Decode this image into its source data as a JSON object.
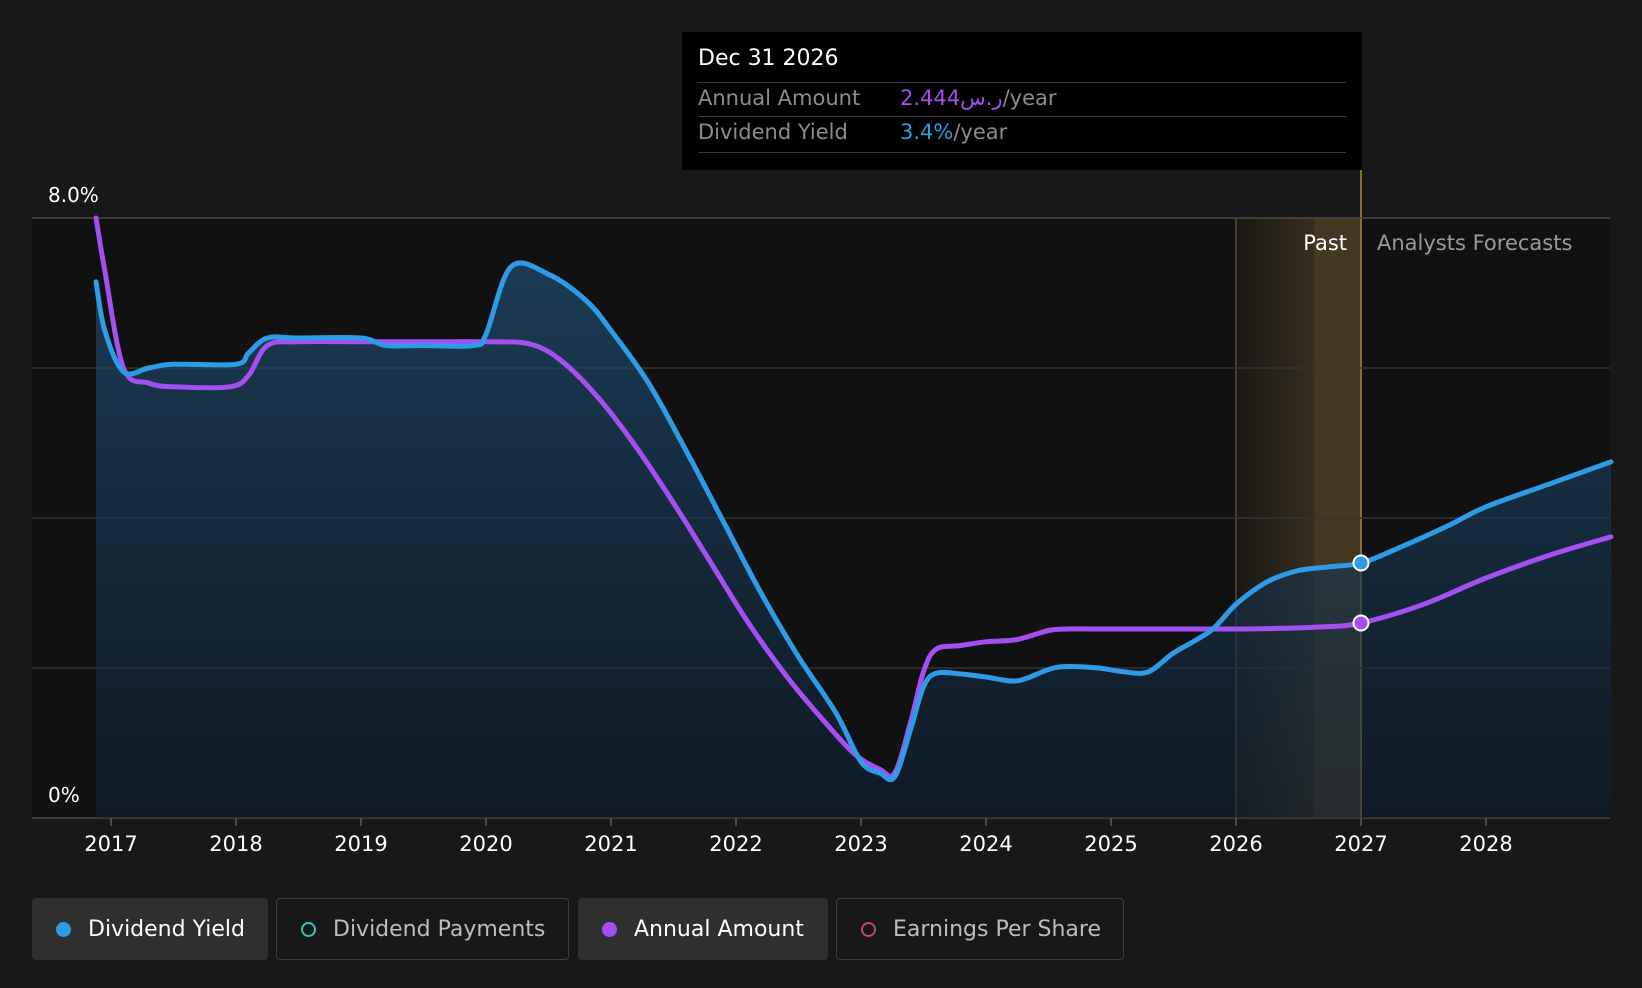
{
  "tooltip": {
    "date": "Dec 31 2026",
    "rows": [
      {
        "label": "Annual Amount",
        "value": "2.444ر.س",
        "unit": "/year",
        "color": "#a34ff2"
      },
      {
        "label": "Dividend Yield",
        "value": "3.4%",
        "unit": "/year",
        "color": "#2e9be6"
      }
    ]
  },
  "legend": [
    {
      "label": "Dividend Yield",
      "color": "#2e9be6",
      "active": true,
      "filled": true
    },
    {
      "label": "Dividend Payments",
      "color": "#3fc1b0",
      "active": false,
      "filled": false
    },
    {
      "label": "Annual Amount",
      "color": "#a34ff2",
      "active": true,
      "filled": true
    },
    {
      "label": "Earnings Per Share",
      "color": "#c0447e",
      "active": false,
      "filled": false
    }
  ],
  "chart_data": {
    "type": "line",
    "y_tick_labels": [
      "8.0%",
      "0%"
    ],
    "ylim": [
      0,
      8
    ],
    "xlim": [
      2016.5,
      2029.0
    ],
    "x_ticks": [
      "2017",
      "2018",
      "2019",
      "2020",
      "2021",
      "2022",
      "2023",
      "2024",
      "2025",
      "2026",
      "2027",
      "2028"
    ],
    "region_labels": {
      "past": "Past",
      "forecast": "Analysts Forecasts"
    },
    "past_end": 2027.0,
    "shaded_start": 2026.0,
    "grid": true,
    "colors": {
      "background": "#181818",
      "plot": "#111111",
      "grid": "#3a3a3a",
      "band": "#8a6d3b"
    },
    "series": [
      {
        "name": "Dividend Yield",
        "color": "#2e9be6",
        "area": true,
        "points": [
          [
            2016.88,
            7.15
          ],
          [
            2016.95,
            6.5
          ],
          [
            2017.1,
            5.95
          ],
          [
            2017.3,
            6.0
          ],
          [
            2017.5,
            6.05
          ],
          [
            2018.0,
            6.05
          ],
          [
            2018.1,
            6.2
          ],
          [
            2018.25,
            6.4
          ],
          [
            2018.5,
            6.4
          ],
          [
            2019.0,
            6.4
          ],
          [
            2019.2,
            6.3
          ],
          [
            2019.5,
            6.3
          ],
          [
            2019.9,
            6.3
          ],
          [
            2020.0,
            6.45
          ],
          [
            2020.2,
            7.35
          ],
          [
            2020.5,
            7.25
          ],
          [
            2020.8,
            6.9
          ],
          [
            2021.0,
            6.5
          ],
          [
            2021.3,
            5.8
          ],
          [
            2021.6,
            4.9
          ],
          [
            2021.9,
            3.95
          ],
          [
            2022.2,
            3.0
          ],
          [
            2022.5,
            2.15
          ],
          [
            2022.8,
            1.4
          ],
          [
            2023.0,
            0.75
          ],
          [
            2023.15,
            0.6
          ],
          [
            2023.27,
            0.55
          ],
          [
            2023.4,
            1.2
          ],
          [
            2023.5,
            1.75
          ],
          [
            2023.6,
            1.93
          ],
          [
            2023.8,
            1.92
          ],
          [
            2024.0,
            1.88
          ],
          [
            2024.25,
            1.83
          ],
          [
            2024.5,
            1.98
          ],
          [
            2024.65,
            2.02
          ],
          [
            2024.9,
            2.0
          ],
          [
            2025.1,
            1.95
          ],
          [
            2025.3,
            1.95
          ],
          [
            2025.5,
            2.2
          ],
          [
            2025.8,
            2.5
          ],
          [
            2026.0,
            2.85
          ],
          [
            2026.25,
            3.15
          ],
          [
            2026.5,
            3.3
          ],
          [
            2026.75,
            3.35
          ],
          [
            2027.0,
            3.4
          ],
          [
            2027.3,
            3.6
          ],
          [
            2027.7,
            3.9
          ],
          [
            2028.0,
            4.15
          ],
          [
            2028.5,
            4.45
          ],
          [
            2029.0,
            4.75
          ]
        ]
      },
      {
        "name": "Annual Amount",
        "color": "#a34ff2",
        "area": false,
        "points": [
          [
            2016.88,
            8.0
          ],
          [
            2016.95,
            7.3
          ],
          [
            2017.1,
            6.0
          ],
          [
            2017.3,
            5.8
          ],
          [
            2017.5,
            5.75
          ],
          [
            2017.95,
            5.75
          ],
          [
            2018.1,
            5.9
          ],
          [
            2018.25,
            6.3
          ],
          [
            2018.5,
            6.35
          ],
          [
            2019.0,
            6.35
          ],
          [
            2019.5,
            6.35
          ],
          [
            2020.0,
            6.35
          ],
          [
            2020.35,
            6.32
          ],
          [
            2020.6,
            6.1
          ],
          [
            2020.9,
            5.6
          ],
          [
            2021.2,
            4.95
          ],
          [
            2021.5,
            4.2
          ],
          [
            2021.8,
            3.4
          ],
          [
            2022.1,
            2.6
          ],
          [
            2022.4,
            1.9
          ],
          [
            2022.7,
            1.3
          ],
          [
            2022.95,
            0.85
          ],
          [
            2023.15,
            0.65
          ],
          [
            2023.27,
            0.6
          ],
          [
            2023.4,
            1.3
          ],
          [
            2023.5,
            1.95
          ],
          [
            2023.6,
            2.25
          ],
          [
            2023.8,
            2.3
          ],
          [
            2024.0,
            2.35
          ],
          [
            2024.25,
            2.38
          ],
          [
            2024.5,
            2.5
          ],
          [
            2024.65,
            2.52
          ],
          [
            2025.0,
            2.52
          ],
          [
            2025.5,
            2.52
          ],
          [
            2026.0,
            2.52
          ],
          [
            2026.4,
            2.53
          ],
          [
            2026.7,
            2.55
          ],
          [
            2027.0,
            2.6
          ],
          [
            2027.5,
            2.85
          ],
          [
            2028.0,
            3.2
          ],
          [
            2028.5,
            3.5
          ],
          [
            2029.0,
            3.75
          ]
        ]
      }
    ],
    "markers": [
      {
        "series": "Dividend Yield",
        "x": 2027.0,
        "y": 3.4
      },
      {
        "series": "Annual Amount",
        "x": 2027.0,
        "y": 2.6
      }
    ]
  }
}
